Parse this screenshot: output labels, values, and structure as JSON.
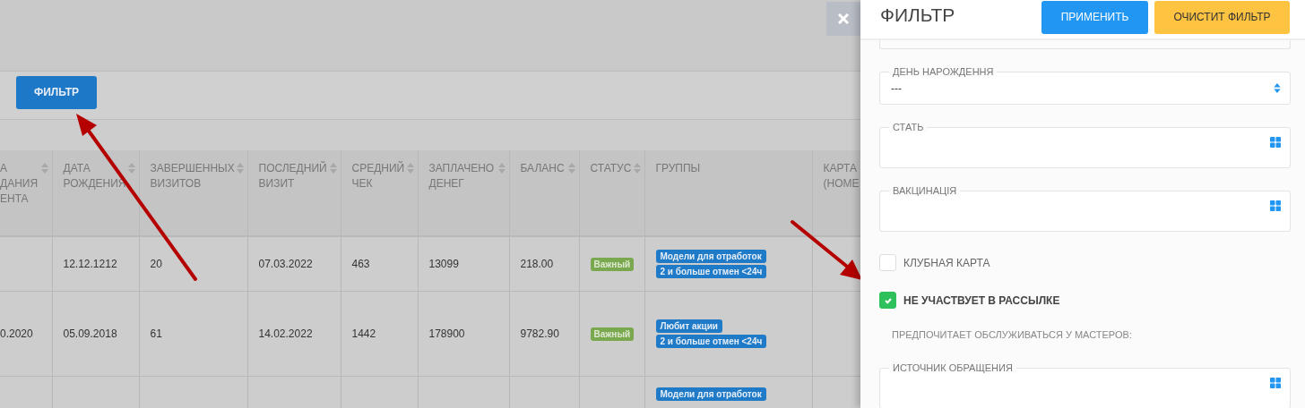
{
  "toolbar": {
    "filter_button": "ФИЛЬТР"
  },
  "table": {
    "columns": [
      {
        "label": "А\nДАНИЯ\nЕНТА",
        "sortable": true
      },
      {
        "label": "ДАТА\nРОЖДЕНИЯ",
        "sortable": true
      },
      {
        "label": "ЗАВЕРШЕННЫХ\nВИЗИТОВ",
        "sortable": true
      },
      {
        "label": "ПОСЛЕДНИЙ\nВИЗИТ",
        "sortable": true
      },
      {
        "label": "СРЕДНИЙ\nЧЕК",
        "sortable": true
      },
      {
        "label": "ЗАПЛАЧЕНО\nДЕНЕГ",
        "sortable": true
      },
      {
        "label": "БАЛАНС",
        "sortable": true
      },
      {
        "label": "СТАТУС",
        "sortable": true
      },
      {
        "label": "ГРУППЫ",
        "sortable": false
      },
      {
        "label": "КАРТА\n(НОМЕ",
        "sortable": false
      }
    ],
    "rows": [
      {
        "cells": [
          "",
          "12.12.1212",
          "20",
          "07.03.2022",
          "463",
          "13099",
          "218.00"
        ],
        "status": "Важный",
        "groups": [
          "Модели для отработок",
          "2 и больше отмен <24ч"
        ]
      },
      {
        "cells": [
          "0.2020",
          "05.09.2018",
          "61",
          "14.02.2022",
          "1442",
          "178900",
          "9782.90"
        ],
        "status": "Важный",
        "groups": [
          "Любит акции",
          "2 и больше отмен <24ч"
        ]
      },
      {
        "cells": [],
        "groups": [
          "Модели для отработок"
        ]
      }
    ]
  },
  "filter_panel": {
    "title": "ФИЛЬТР",
    "apply_button": "ПРИМЕНИТЬ",
    "clear_button": "ОЧИСТИТ ФИЛЬТР",
    "items": [
      {
        "kind": "select",
        "label": "ДЕНЬ НАРОЖДЕННЯ",
        "value": "---"
      },
      {
        "kind": "multiselect",
        "label": "СТАТЬ"
      },
      {
        "kind": "multiselect",
        "label": "ВАКЦИНАЦІЯ"
      },
      {
        "kind": "checkbox",
        "label": "КЛУБНАЯ КАРТА",
        "checked": false
      },
      {
        "kind": "checkbox",
        "label": "НЕ УЧАСТВУЕТ В РАССЫЛКЕ",
        "checked": true
      },
      {
        "kind": "heading",
        "label": "ПРЕДПОЧИТАЕТ ОБСЛУЖИВАТЬСЯ У МАСТЕРОВ:"
      },
      {
        "kind": "multiselect",
        "label": "ИСТОЧНИК ОБРАЩЕНИЯ"
      }
    ]
  }
}
